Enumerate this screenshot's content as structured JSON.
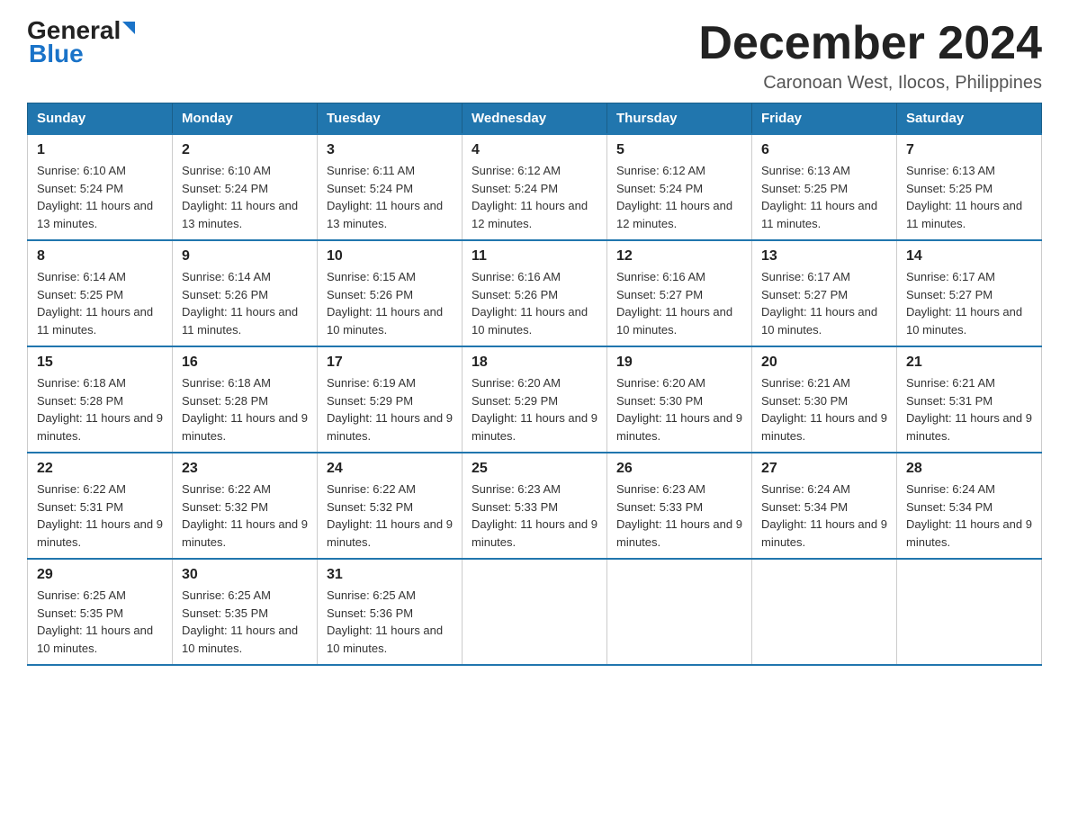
{
  "header": {
    "logo_general": "General",
    "logo_blue": "Blue",
    "month_title": "December 2024",
    "location": "Caronoan West, Ilocos, Philippines"
  },
  "days_of_week": [
    "Sunday",
    "Monday",
    "Tuesday",
    "Wednesday",
    "Thursday",
    "Friday",
    "Saturday"
  ],
  "weeks": [
    [
      {
        "num": "1",
        "sunrise": "6:10 AM",
        "sunset": "5:24 PM",
        "daylight": "11 hours and 13 minutes."
      },
      {
        "num": "2",
        "sunrise": "6:10 AM",
        "sunset": "5:24 PM",
        "daylight": "11 hours and 13 minutes."
      },
      {
        "num": "3",
        "sunrise": "6:11 AM",
        "sunset": "5:24 PM",
        "daylight": "11 hours and 13 minutes."
      },
      {
        "num": "4",
        "sunrise": "6:12 AM",
        "sunset": "5:24 PM",
        "daylight": "11 hours and 12 minutes."
      },
      {
        "num": "5",
        "sunrise": "6:12 AM",
        "sunset": "5:24 PM",
        "daylight": "11 hours and 12 minutes."
      },
      {
        "num": "6",
        "sunrise": "6:13 AM",
        "sunset": "5:25 PM",
        "daylight": "11 hours and 11 minutes."
      },
      {
        "num": "7",
        "sunrise": "6:13 AM",
        "sunset": "5:25 PM",
        "daylight": "11 hours and 11 minutes."
      }
    ],
    [
      {
        "num": "8",
        "sunrise": "6:14 AM",
        "sunset": "5:25 PM",
        "daylight": "11 hours and 11 minutes."
      },
      {
        "num": "9",
        "sunrise": "6:14 AM",
        "sunset": "5:26 PM",
        "daylight": "11 hours and 11 minutes."
      },
      {
        "num": "10",
        "sunrise": "6:15 AM",
        "sunset": "5:26 PM",
        "daylight": "11 hours and 10 minutes."
      },
      {
        "num": "11",
        "sunrise": "6:16 AM",
        "sunset": "5:26 PM",
        "daylight": "11 hours and 10 minutes."
      },
      {
        "num": "12",
        "sunrise": "6:16 AM",
        "sunset": "5:27 PM",
        "daylight": "11 hours and 10 minutes."
      },
      {
        "num": "13",
        "sunrise": "6:17 AM",
        "sunset": "5:27 PM",
        "daylight": "11 hours and 10 minutes."
      },
      {
        "num": "14",
        "sunrise": "6:17 AM",
        "sunset": "5:27 PM",
        "daylight": "11 hours and 10 minutes."
      }
    ],
    [
      {
        "num": "15",
        "sunrise": "6:18 AM",
        "sunset": "5:28 PM",
        "daylight": "11 hours and 9 minutes."
      },
      {
        "num": "16",
        "sunrise": "6:18 AM",
        "sunset": "5:28 PM",
        "daylight": "11 hours and 9 minutes."
      },
      {
        "num": "17",
        "sunrise": "6:19 AM",
        "sunset": "5:29 PM",
        "daylight": "11 hours and 9 minutes."
      },
      {
        "num": "18",
        "sunrise": "6:20 AM",
        "sunset": "5:29 PM",
        "daylight": "11 hours and 9 minutes."
      },
      {
        "num": "19",
        "sunrise": "6:20 AM",
        "sunset": "5:30 PM",
        "daylight": "11 hours and 9 minutes."
      },
      {
        "num": "20",
        "sunrise": "6:21 AM",
        "sunset": "5:30 PM",
        "daylight": "11 hours and 9 minutes."
      },
      {
        "num": "21",
        "sunrise": "6:21 AM",
        "sunset": "5:31 PM",
        "daylight": "11 hours and 9 minutes."
      }
    ],
    [
      {
        "num": "22",
        "sunrise": "6:22 AM",
        "sunset": "5:31 PM",
        "daylight": "11 hours and 9 minutes."
      },
      {
        "num": "23",
        "sunrise": "6:22 AM",
        "sunset": "5:32 PM",
        "daylight": "11 hours and 9 minutes."
      },
      {
        "num": "24",
        "sunrise": "6:22 AM",
        "sunset": "5:32 PM",
        "daylight": "11 hours and 9 minutes."
      },
      {
        "num": "25",
        "sunrise": "6:23 AM",
        "sunset": "5:33 PM",
        "daylight": "11 hours and 9 minutes."
      },
      {
        "num": "26",
        "sunrise": "6:23 AM",
        "sunset": "5:33 PM",
        "daylight": "11 hours and 9 minutes."
      },
      {
        "num": "27",
        "sunrise": "6:24 AM",
        "sunset": "5:34 PM",
        "daylight": "11 hours and 9 minutes."
      },
      {
        "num": "28",
        "sunrise": "6:24 AM",
        "sunset": "5:34 PM",
        "daylight": "11 hours and 9 minutes."
      }
    ],
    [
      {
        "num": "29",
        "sunrise": "6:25 AM",
        "sunset": "5:35 PM",
        "daylight": "11 hours and 10 minutes."
      },
      {
        "num": "30",
        "sunrise": "6:25 AM",
        "sunset": "5:35 PM",
        "daylight": "11 hours and 10 minutes."
      },
      {
        "num": "31",
        "sunrise": "6:25 AM",
        "sunset": "5:36 PM",
        "daylight": "11 hours and 10 minutes."
      },
      null,
      null,
      null,
      null
    ]
  ]
}
